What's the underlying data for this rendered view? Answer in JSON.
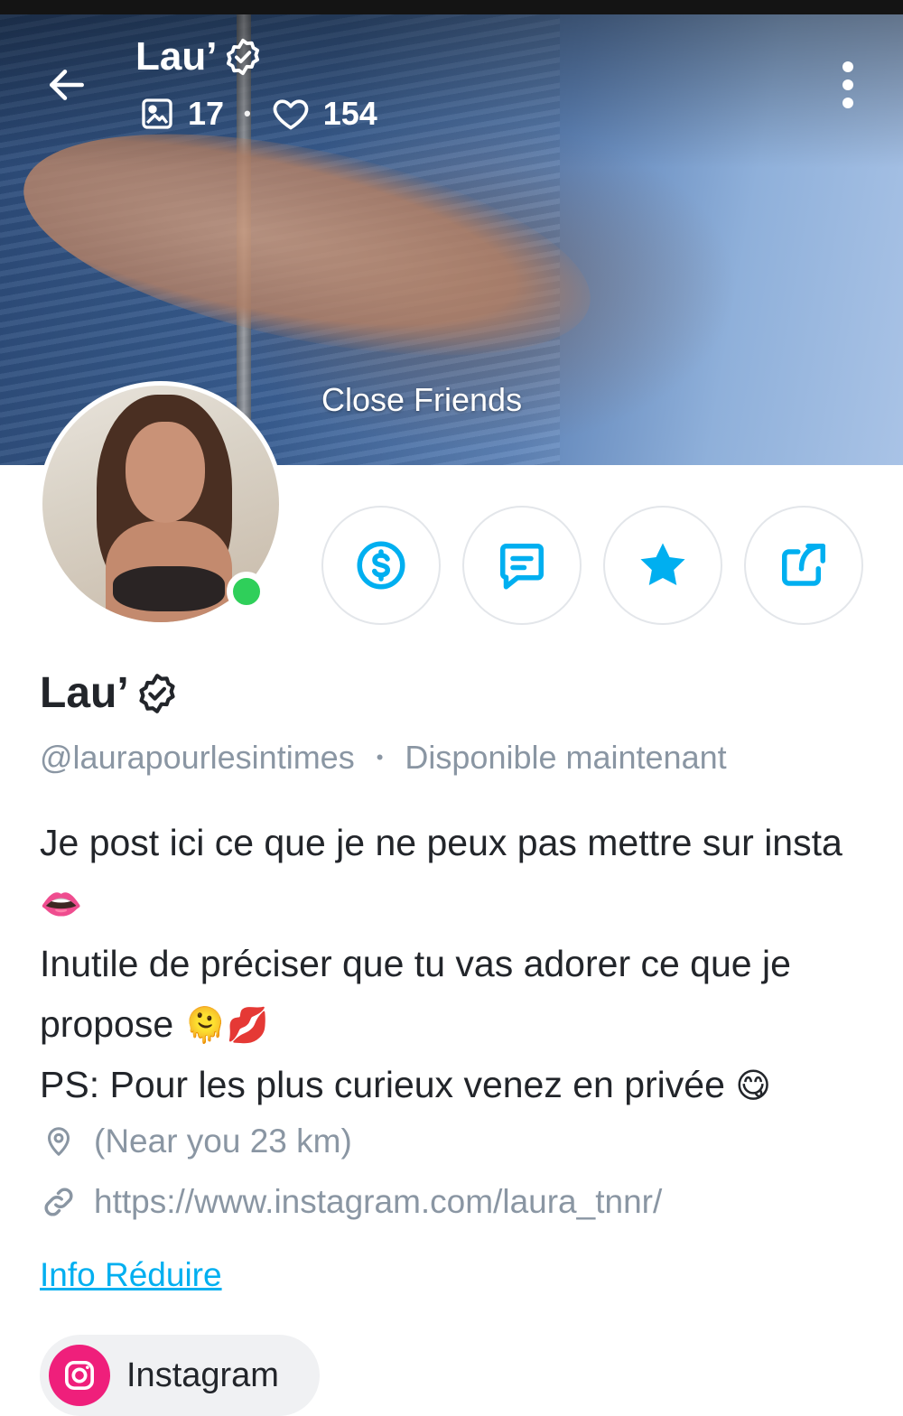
{
  "header": {
    "title": "Lau’",
    "media_count": "17",
    "likes_count": "154",
    "separator": "•"
  },
  "cover": {
    "caption": "Close Friends"
  },
  "profile": {
    "name": "Lau’",
    "username": "@laurapourlesintimes",
    "separator": "•",
    "status": "Disponible maintenant",
    "online": true
  },
  "bio": {
    "line1": "Je post ici ce que je ne peux pas mettre sur insta",
    "line1_emoji": "👄",
    "line2": "Inutile de préciser que tu vas adorer ce que je propose",
    "line2_emoji": "🫠💋",
    "line3": "PS: Pour les plus curieux venez en privée",
    "line3_emoji": "😋"
  },
  "info": {
    "location": "(Near you 23 km)",
    "link": "https://www.instagram.com/laura_tnnr/"
  },
  "toggle_label": "Info Réduire",
  "social": {
    "label": "Instagram"
  },
  "icons": {
    "back": "arrow-left-icon",
    "media": "image-icon",
    "likes": "heart-icon",
    "more": "more-vertical-icon",
    "tip": "dollar-circle-icon",
    "message": "message-icon",
    "favorite": "star-icon",
    "share": "share-icon",
    "location": "map-pin-icon",
    "link": "link-icon",
    "instagram": "instagram-icon",
    "verified": "verified-badge-icon"
  },
  "colors": {
    "accent": "#00aff0",
    "online": "#2fcf5a",
    "instagram": "#ef1f7b",
    "muted": "#8a96a3"
  }
}
